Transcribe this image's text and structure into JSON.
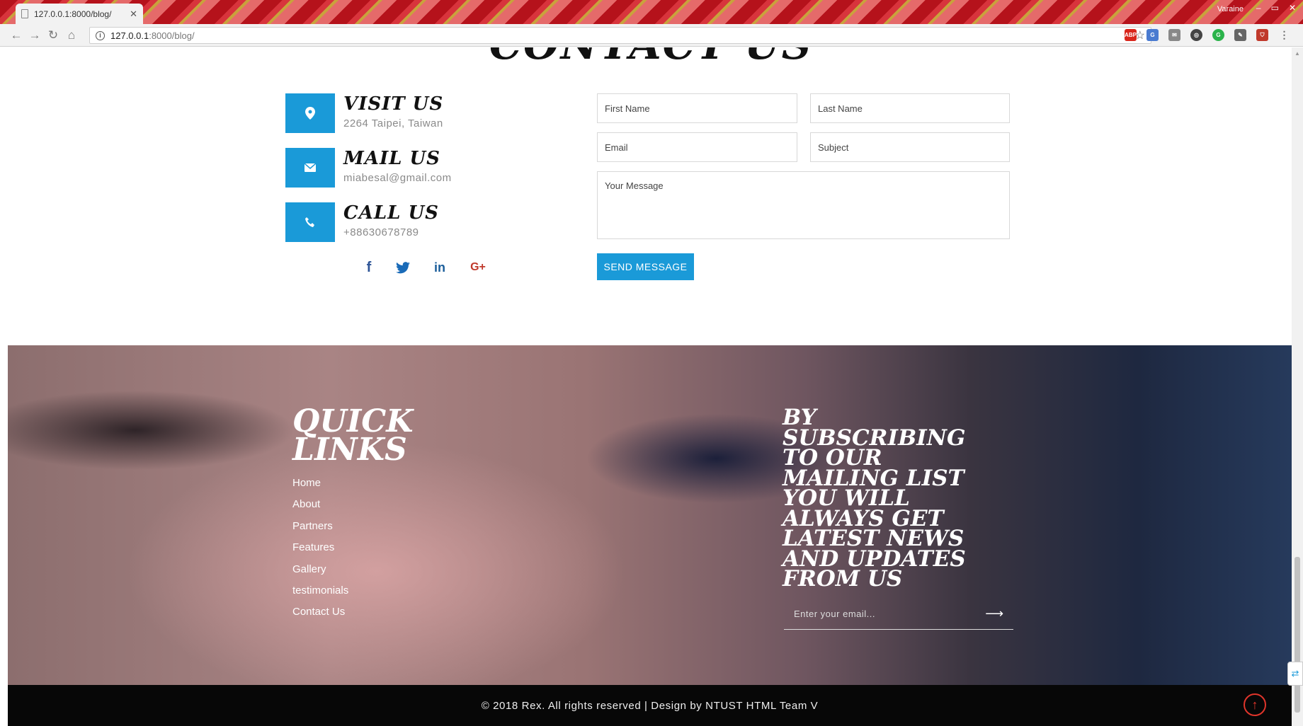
{
  "browser": {
    "tab_title": "127.0.0.1:8000/blog/",
    "url_host": "127.0.0.1",
    "url_path": ":8000/blog/",
    "user_label": "Varaine"
  },
  "contact": {
    "heading": "CONTACT US",
    "items": [
      {
        "title": "VISIT US",
        "value": "2264 Taipei, Taiwan",
        "icon": "map-marker-icon"
      },
      {
        "title": "MAIL US",
        "value": "miabesal@gmail.com",
        "icon": "envelope-icon"
      },
      {
        "title": "CALL US",
        "value": "+88630678789",
        "icon": "phone-icon"
      }
    ],
    "social": [
      "facebook-icon",
      "twitter-icon",
      "linkedin-icon",
      "google-plus-icon"
    ],
    "social_labels": {
      "facebook": "f",
      "linkedin": "in",
      "google": "G+"
    }
  },
  "form": {
    "first_name": "First Name",
    "last_name": "Last Name",
    "email": "Email",
    "subject": "Subject",
    "message": "Your Message",
    "send_label": "SEND MESSAGE"
  },
  "footer": {
    "quick_links_heading": "QUICK LINKS",
    "links": [
      "Home",
      "About",
      "Partners",
      "Features",
      "Gallery",
      "testimonials",
      "Contact Us"
    ],
    "subscribe_heading": "BY SUBSCRIBING TO OUR MAILING LIST YOU WILL ALWAYS GET LATEST NEWS AND UPDATES FROM US",
    "email_placeholder": "Enter your email...",
    "copyright": "© 2018 Rex. All rights reserved | Design by NTUST HTML Team V"
  },
  "colors": {
    "accent": "#1a9ad8",
    "footer_bar": "#070707",
    "to_top": "#e0352b"
  }
}
